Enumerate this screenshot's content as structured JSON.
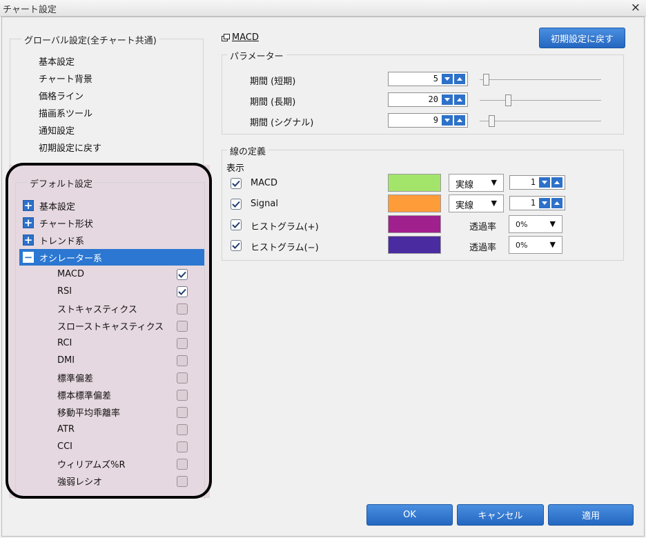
{
  "window": {
    "title": "チャート設定",
    "close_glyph": "×"
  },
  "global_settings": {
    "legend": "グローバル設定(全チャート共通)",
    "items": [
      "基本設定",
      "チャート背景",
      "価格ライン",
      "描画系ツール",
      "通知設定",
      "初期設定に戻す"
    ]
  },
  "default_settings": {
    "legend": "デフォルト設定",
    "categories": [
      {
        "label": "基本設定",
        "toggle": "+"
      },
      {
        "label": "チャート形状",
        "toggle": "+"
      },
      {
        "label": "トレンド系",
        "toggle": "+"
      },
      {
        "label": "オシレーター系",
        "toggle": "−"
      }
    ],
    "oscillators": [
      {
        "label": "MACD",
        "checked": true
      },
      {
        "label": "RSI",
        "checked": true
      },
      {
        "label": "ストキャスティクス",
        "checked": false
      },
      {
        "label": "スローストキャスティクス",
        "checked": false
      },
      {
        "label": "RCI",
        "checked": false
      },
      {
        "label": "DMI",
        "checked": false
      },
      {
        "label": "標準偏差",
        "checked": false
      },
      {
        "label": "標本標準偏差",
        "checked": false
      },
      {
        "label": "移動平均乖離率",
        "checked": false
      },
      {
        "label": "ATR",
        "checked": false
      },
      {
        "label": "CCI",
        "checked": false
      },
      {
        "label": "ウィリアムズ%R",
        "checked": false
      },
      {
        "label": "強弱レシオ",
        "checked": false
      }
    ]
  },
  "macd": {
    "title": "MACD",
    "reset_button": "初期設定に戻す",
    "params_legend": "パラメーター",
    "params": [
      {
        "label": "期間 (短期)",
        "value": "5",
        "slider_fraction": 0.0
      },
      {
        "label": "期間 (長期)",
        "value": "20",
        "slider_fraction": 0.2
      },
      {
        "label": "期間 (シグナル)",
        "value": "9",
        "slider_fraction": 0.05
      }
    ],
    "lines_legend": "線の定義",
    "display_label": "表示",
    "lines": [
      {
        "name": "MACD",
        "checked": true,
        "color": "#a3e46b",
        "style": "実線",
        "width": "1"
      },
      {
        "name": "Signal",
        "checked": true,
        "color": "#ff9c3a",
        "style": "実線",
        "width": "1"
      },
      {
        "name": "ヒストグラム(+)",
        "checked": true,
        "color": "#a0208e",
        "transparency_label": "透過率",
        "transparency": "0%"
      },
      {
        "name": "ヒストグラム(−)",
        "checked": true,
        "color": "#4a2ca0",
        "transparency_label": "透過率",
        "transparency": "0%"
      }
    ]
  },
  "buttons": {
    "ok": "OK",
    "cancel": "キャンセル",
    "apply": "適用"
  },
  "colors": {
    "accent": "#2d71c9",
    "selected_row": "#2b77d1",
    "default_panel_bg": "#e6d8e0"
  }
}
